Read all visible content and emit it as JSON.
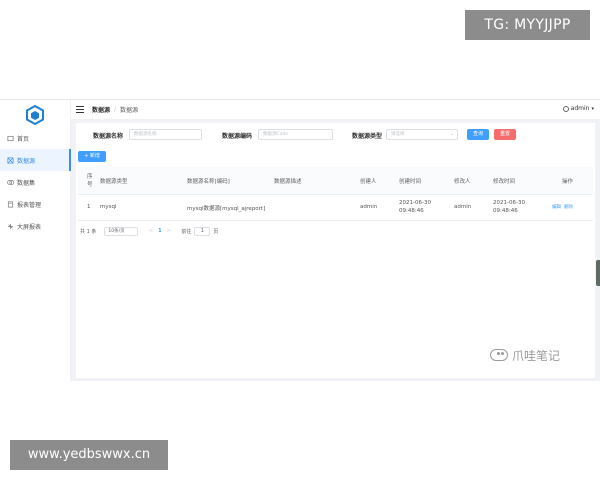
{
  "watermarks": {
    "top": "TG: MYYJJPP",
    "bottom": "www.yedbswwx.cn",
    "wechat": "爪哇笔记"
  },
  "sidebar": {
    "items": [
      {
        "label": "首页",
        "icon": "home-icon",
        "active": false
      },
      {
        "label": "数据源",
        "icon": "datasource-icon",
        "active": true
      },
      {
        "label": "数据集",
        "icon": "dataset-icon",
        "active": false
      },
      {
        "label": "报表管理",
        "icon": "report-icon",
        "active": false
      },
      {
        "label": "大屏报表",
        "icon": "screen-icon",
        "active": false
      }
    ]
  },
  "header": {
    "breadcrumb_1": "数据源",
    "breadcrumb_sep": "/",
    "breadcrumb_2": "数据源",
    "user": "admin"
  },
  "filter": {
    "name_label": "数据源名称",
    "name_placeholder": "数据源名称",
    "code_label": "数据源编码",
    "code_placeholder": "数据源Code",
    "type_label": "数据源类型",
    "type_placeholder": "请选择",
    "search_button": "查询",
    "reset_button": "重置"
  },
  "toolbar": {
    "add_button": "+ 新增"
  },
  "table": {
    "headers": {
      "index": "序号",
      "type": "数据源类型",
      "name": "数据源名称[编码]",
      "desc": "数据源描述",
      "creator": "创建人",
      "created_at": "创建时间",
      "modifier": "修改人",
      "modified_at": "修改时间",
      "actions": "操作"
    },
    "rows": [
      {
        "index": "1",
        "type": "mysql",
        "name": "mysql数据源[mysql_ajreport]",
        "desc": "",
        "creator": "admin",
        "created_at": "2021-06-30 09:48:46",
        "modifier": "admin",
        "modified_at": "2021-06-30 09:48:46",
        "edit": "编辑",
        "delete": "删除"
      }
    ]
  },
  "pagination": {
    "total": "共 1 条",
    "page_size": "10条/页",
    "prev": "<",
    "current": "1",
    "next": ">",
    "goto_label": "前往",
    "goto_value": "1",
    "goto_unit": "页"
  },
  "colors": {
    "primary": "#409eff",
    "danger": "#f56c6c",
    "active_menu_bg": "#ecf5ff",
    "content_bg": "#f0f2f5"
  }
}
